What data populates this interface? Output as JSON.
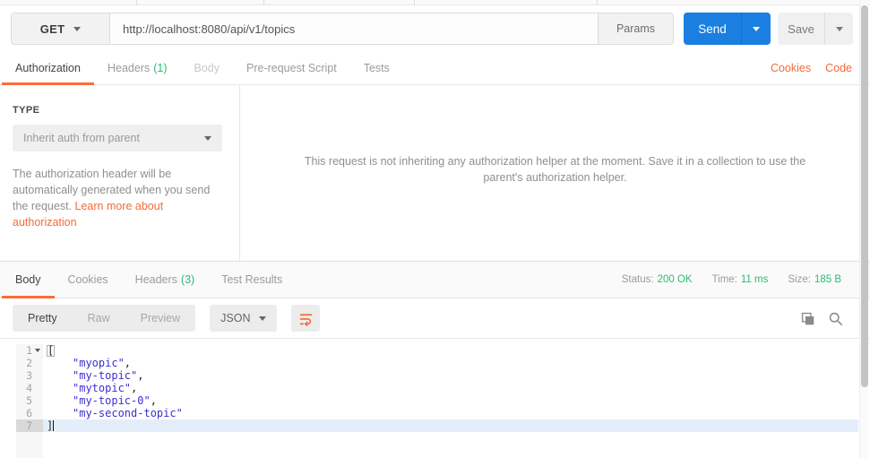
{
  "request_bar": {
    "method": "GET",
    "url": "http://localhost:8080/api/v1/topics",
    "params_label": "Params",
    "send_label": "Send",
    "save_label": "Save"
  },
  "request_tabs": {
    "tabs": [
      {
        "label": "Authorization"
      },
      {
        "label": "Headers",
        "count": "(1)"
      },
      {
        "label": "Body"
      },
      {
        "label": "Pre-request Script"
      },
      {
        "label": "Tests"
      }
    ],
    "cookies_link": "Cookies",
    "code_link": "Code"
  },
  "authorization": {
    "type_label": "TYPE",
    "type_value": "Inherit auth from parent",
    "description": "The authorization header will be automatically generated when you send the request. ",
    "link_text": "Learn more about authorization",
    "helper_text": "This request is not inheriting any authorization helper at the moment. Save it in a collection to use the parent's authorization helper."
  },
  "response": {
    "tabs": [
      {
        "label": "Body"
      },
      {
        "label": "Cookies"
      },
      {
        "label": "Headers",
        "count": "(3)"
      },
      {
        "label": "Test Results"
      }
    ],
    "meta": {
      "status_label": "Status:",
      "status_value": "200 OK",
      "time_label": "Time:",
      "time_value": "11 ms",
      "size_label": "Size:",
      "size_value": "185 B"
    },
    "toolbar": {
      "modes": [
        "Pretty",
        "Raw",
        "Preview"
      ],
      "format": "JSON"
    },
    "code": {
      "lines": [
        {
          "num": "1",
          "text": "["
        },
        {
          "num": "2",
          "str": "\"myopic\"",
          "punct": ","
        },
        {
          "num": "3",
          "str": "\"my-topic\"",
          "punct": ","
        },
        {
          "num": "4",
          "str": "\"mytopic\"",
          "punct": ","
        },
        {
          "num": "5",
          "str": "\"my-topic-0\"",
          "punct": ","
        },
        {
          "num": "6",
          "str": "\"my-second-topic\"",
          "punct": ""
        },
        {
          "num": "7",
          "text": "]"
        }
      ]
    }
  },
  "colors": {
    "accent_orange": "#ff6c37",
    "link_orange": "#f26b3a",
    "status_green": "#2bbd73",
    "send_blue": "#1a7fe0",
    "string_blue": "#3b2fd4"
  }
}
